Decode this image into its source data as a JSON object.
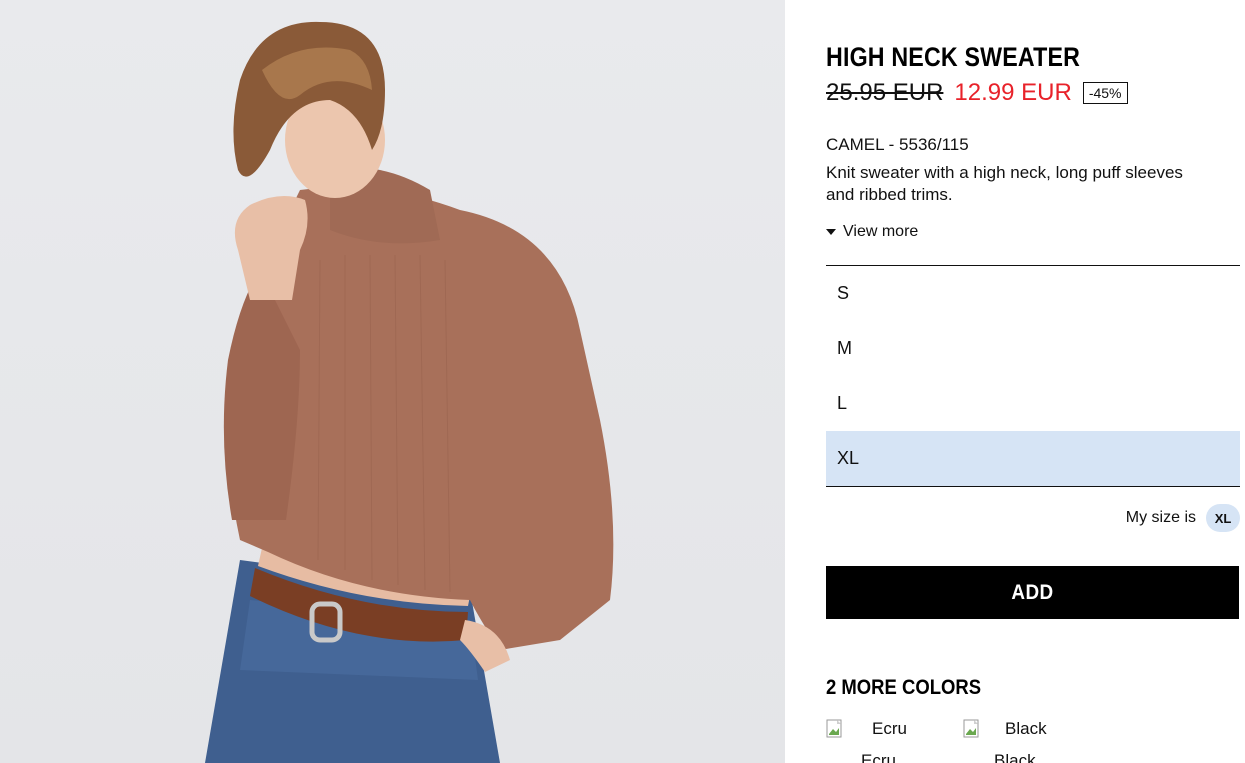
{
  "product": {
    "title": "HIGH NECK SWEATER",
    "old_price": "25.95 EUR",
    "new_price": "12.99 EUR",
    "discount": "-45%",
    "color_ref": "CAMEL - 5536/115",
    "description": "Knit sweater with a high neck, long puff sleeves and ribbed trims.",
    "view_more": "View more"
  },
  "sizes": {
    "items": [
      "S",
      "M",
      "L",
      "XL"
    ],
    "selected": "XL"
  },
  "my_size": {
    "label": "My size is",
    "value": "XL"
  },
  "add_button": "ADD",
  "more_colors": {
    "title": "2 MORE COLORS",
    "items": [
      {
        "alt": "Ecru",
        "name": "Ecru"
      },
      {
        "alt": "Black",
        "name": "Black"
      }
    ]
  },
  "colors": {
    "sale_red": "#e8222a",
    "selected_bg": "#d6e4f5",
    "sweater": "#a8705a"
  },
  "icons": {
    "view_more": "caret-down-icon",
    "color_swatch": "broken-image-icon"
  }
}
